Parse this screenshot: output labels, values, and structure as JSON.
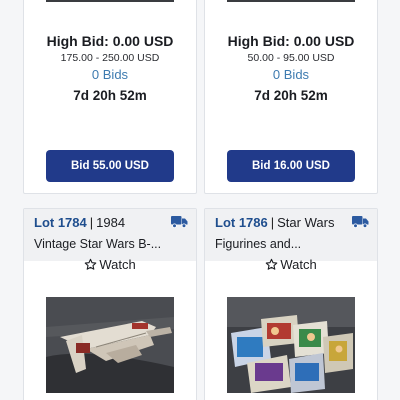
{
  "cards_top": [
    {
      "high_bid": "High Bid: 0.00 USD",
      "range": "175.00 - 250.00 USD",
      "bids": "0 Bids",
      "time_left": "7d 20h 52m",
      "button": "Bid 55.00 USD"
    },
    {
      "high_bid": "High Bid: 0.00 USD",
      "range": "50.00 - 95.00 USD",
      "bids": "0 Bids",
      "time_left": "7d 20h 52m",
      "button": "Bid 16.00 USD"
    }
  ],
  "cards_bottom": [
    {
      "lot": "Lot 1784",
      "category": "1984",
      "title": "Vintage Star Wars B-...",
      "watch": "Watch",
      "shipping_icon": "truck-icon",
      "image": "b-wing-ship-photo"
    },
    {
      "lot": "Lot 1786",
      "category": "Star Wars",
      "title": "Figurines and...",
      "watch": "Watch",
      "shipping_icon": "truck-icon",
      "image": "figurines-photo"
    }
  ],
  "colors": {
    "button": "#213a8a",
    "lot_link": "#1f4e8e",
    "bids_link": "#3e7bb0"
  }
}
